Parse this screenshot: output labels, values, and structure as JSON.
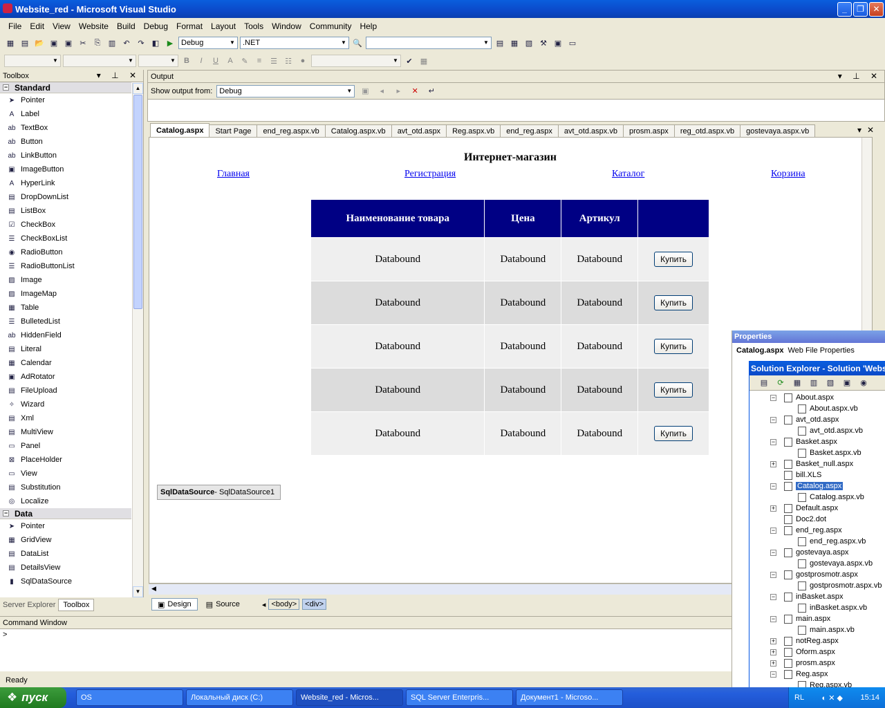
{
  "window": {
    "title": "Website_red - Microsoft Visual Studio",
    "minimize": "_",
    "maximize": "❐",
    "close": "✕"
  },
  "menu": [
    "File",
    "Edit",
    "View",
    "Website",
    "Build",
    "Debug",
    "Format",
    "Layout",
    "Tools",
    "Window",
    "Community",
    "Help"
  ],
  "toolbar": {
    "config": "Debug",
    "platform": ".NET"
  },
  "toolbox": {
    "title": "Toolbox",
    "groups": [
      {
        "name": "Standard",
        "items": [
          "Pointer",
          "Label",
          "TextBox",
          "Button",
          "LinkButton",
          "ImageButton",
          "HyperLink",
          "DropDownList",
          "ListBox",
          "CheckBox",
          "CheckBoxList",
          "RadioButton",
          "RadioButtonList",
          "Image",
          "ImageMap",
          "Table",
          "BulletedList",
          "HiddenField",
          "Literal",
          "Calendar",
          "AdRotator",
          "FileUpload",
          "Wizard",
          "Xml",
          "MultiView",
          "Panel",
          "PlaceHolder",
          "View",
          "Substitution",
          "Localize"
        ]
      },
      {
        "name": "Data",
        "items": [
          "Pointer",
          "GridView",
          "DataList",
          "DetailsView",
          "SqlDataSource"
        ]
      }
    ],
    "tabs": [
      "Server Explorer",
      "Toolbox"
    ]
  },
  "output": {
    "title": "Output",
    "show_label": "Show output from:",
    "source": "Debug"
  },
  "doc_tabs": [
    "Catalog.aspx",
    "Start Page",
    "end_reg.aspx.vb",
    "Catalog.aspx.vb",
    "avt_otd.aspx",
    "Reg.aspx.vb",
    "end_reg.aspx",
    "avt_otd.aspx.vb",
    "prosm.aspx",
    "reg_otd.aspx.vb",
    "gostevaya.aspx.vb"
  ],
  "page": {
    "title": "Интернет-магазин",
    "nav": [
      "Главная",
      "Регистрация",
      "Каталог",
      "Корзина"
    ],
    "grid": {
      "headers": [
        "Наименование товара",
        "Цена",
        "Артикул",
        ""
      ],
      "rows": [
        [
          "Databound",
          "Databound",
          "Databound",
          "Купить"
        ],
        [
          "Databound",
          "Databound",
          "Databound",
          "Купить"
        ],
        [
          "Databound",
          "Databound",
          "Databound",
          "Купить"
        ],
        [
          "Databound",
          "Databound",
          "Databound",
          "Купить"
        ],
        [
          "Databound",
          "Databound",
          "Databound",
          "Купить"
        ]
      ]
    },
    "datasource": {
      "name": "SqlDataSource",
      "id": " - SqlDataSource1"
    }
  },
  "designbar": {
    "design": "Design",
    "source": "Source",
    "tags": [
      "<body>",
      "<div>"
    ]
  },
  "command": {
    "title": "Command Window",
    "prompt": ">"
  },
  "status": "Ready",
  "properties": {
    "title": "Properties",
    "object": "Catalog.aspx",
    "object_type": "Web File Properties"
  },
  "solution": {
    "title": "Solution Explorer - Solution 'Websit",
    "tree": [
      {
        "label": "About.aspx",
        "level": 0,
        "exp": "-"
      },
      {
        "label": "About.aspx.vb",
        "level": 1
      },
      {
        "label": "avt_otd.aspx",
        "level": 0,
        "exp": "-"
      },
      {
        "label": "avt_otd.aspx.vb",
        "level": 1
      },
      {
        "label": "Basket.aspx",
        "level": 0,
        "exp": "-"
      },
      {
        "label": "Basket.aspx.vb",
        "level": 1
      },
      {
        "label": "Basket_null.aspx",
        "level": 0,
        "exp": "+"
      },
      {
        "label": "bill.XLS",
        "level": 0
      },
      {
        "label": "Catalog.aspx",
        "level": 0,
        "exp": "-",
        "selected": true
      },
      {
        "label": "Catalog.aspx.vb",
        "level": 1
      },
      {
        "label": "Default.aspx",
        "level": 0,
        "exp": "+"
      },
      {
        "label": "Doc2.dot",
        "level": 0
      },
      {
        "label": "end_reg.aspx",
        "level": 0,
        "exp": "-"
      },
      {
        "label": "end_reg.aspx.vb",
        "level": 1
      },
      {
        "label": "gostevaya.aspx",
        "level": 0,
        "exp": "-"
      },
      {
        "label": "gostevaya.aspx.vb",
        "level": 1
      },
      {
        "label": "gostprosmotr.aspx",
        "level": 0,
        "exp": "-"
      },
      {
        "label": "gostprosmotr.aspx.vb",
        "level": 1
      },
      {
        "label": "inBasket.aspx",
        "level": 0,
        "exp": "-"
      },
      {
        "label": "inBasket.aspx.vb",
        "level": 1
      },
      {
        "label": "main.aspx",
        "level": 0,
        "exp": "-"
      },
      {
        "label": "main.aspx.vb",
        "level": 1
      },
      {
        "label": "notReg.aspx",
        "level": 0,
        "exp": "+"
      },
      {
        "label": "Oform.aspx",
        "level": 0,
        "exp": "+"
      },
      {
        "label": "prosm.aspx",
        "level": 0,
        "exp": "+"
      },
      {
        "label": "Reg.aspx",
        "level": 0,
        "exp": "-"
      },
      {
        "label": "Reg.aspx.vb",
        "level": 1
      }
    ]
  },
  "taskbar": {
    "start": "пуск",
    "tasks": [
      "OS",
      "Локальный диск (C:)",
      "Website_red - Micros...",
      "SQL Server Enterpris...",
      "Документ1 - Microso..."
    ],
    "lang": "RL",
    "time": "15:14"
  }
}
